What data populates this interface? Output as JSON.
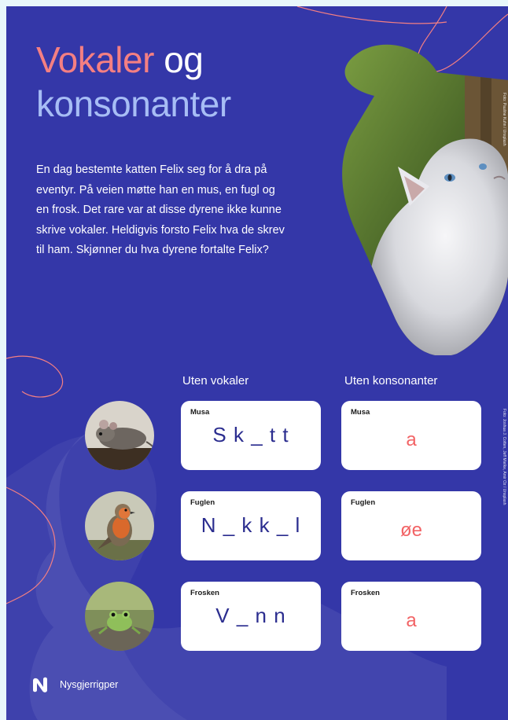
{
  "title": {
    "word_vokaler": "Vokaler",
    "word_og": "og",
    "word_konsonanter": "konsonanter"
  },
  "intro": "En dag bestemte katten Felix seg for å dra på eventyr. På veien møtte han en mus, en fugl og en frosk. Det rare var at disse dyrene ikke kunne skrive vokaler. Heldigvis forsto Felix hva de skrev til ham. Skjønner du hva dyrene fortalte Felix?",
  "hero_credit": "Foto: Pauline Kuhn / Unsplash",
  "animals_credit": "Foto: Joshua J. Cotten, Jeff Mielke, Amir Oz / Unsplash",
  "columns": {
    "without_vowels": "Uten vokaler",
    "without_consonants": "Uten konsonanter"
  },
  "rows": [
    {
      "animal": "mouse",
      "label": "Musa",
      "no_vowels": "Sk_tt",
      "no_consonants": "a"
    },
    {
      "animal": "bird",
      "label": "Fuglen",
      "no_vowels": "N_kk_l",
      "no_consonants": "øe"
    },
    {
      "animal": "frog",
      "label": "Frosken",
      "no_vowels": "V_nn",
      "no_consonants": "a"
    }
  ],
  "brand": "Nysgjerrigper",
  "colors": {
    "background": "#3437a8",
    "title_accent": "#f47f82",
    "title_light": "#a7bdf5",
    "answer_red": "#f26365",
    "card": "#ffffff"
  }
}
